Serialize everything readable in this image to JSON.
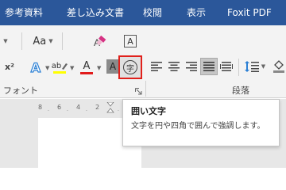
{
  "tabs": [
    "参考資料",
    "差し込み文書",
    "校閲",
    "表示",
    "Foxit PDF"
  ],
  "colors": {
    "tab_bar": "#2b579a",
    "highlight_yellow": "#ffff00",
    "font_color_red": "#e11b1b",
    "selected_outline": "#e0201b"
  },
  "ribbon": {
    "font_group_label": "フォント",
    "paragraph_group_label": "段落",
    "buttons": {
      "change_case": "Aa",
      "clear_formatting": "clear-formatting-icon",
      "character_border": "A",
      "superscript": "x²",
      "text_effects": "A",
      "highlight": "ab",
      "font_color": "A",
      "character_shading": "A",
      "enclose_characters": "字"
    }
  },
  "ruler": {
    "numbers": [
      "8",
      "6",
      "4",
      "2",
      "2"
    ]
  },
  "tooltip": {
    "title": "囲い文字",
    "body": "文字を円や四角で囲んで強調します。"
  }
}
